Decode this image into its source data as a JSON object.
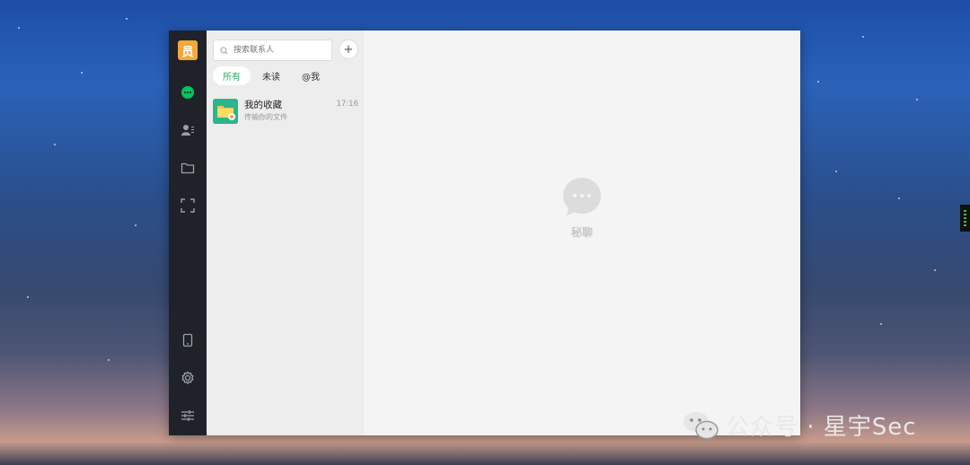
{
  "sidebar": {
    "avatar_text": "员",
    "accent": "#07c160",
    "items": [
      {
        "name": "chat-bubble-icon"
      },
      {
        "name": "contacts-icon"
      },
      {
        "name": "folder-icon"
      },
      {
        "name": "scan-frame-icon"
      },
      {
        "name": "phone-icon"
      },
      {
        "name": "settings-icon"
      },
      {
        "name": "sliders-icon"
      }
    ]
  },
  "search": {
    "placeholder": "搜索联系人"
  },
  "tabs": [
    {
      "label": "所有",
      "active": true
    },
    {
      "label": "未读",
      "active": false
    },
    {
      "label": "@我",
      "active": false
    }
  ],
  "chats": [
    {
      "title": "我的收藏",
      "subtitle": "传输你的文件",
      "time": "17:16"
    }
  ],
  "main": {
    "empty_label": "秘聊"
  },
  "watermark": {
    "text": "公众号 · 星宇Sec"
  }
}
